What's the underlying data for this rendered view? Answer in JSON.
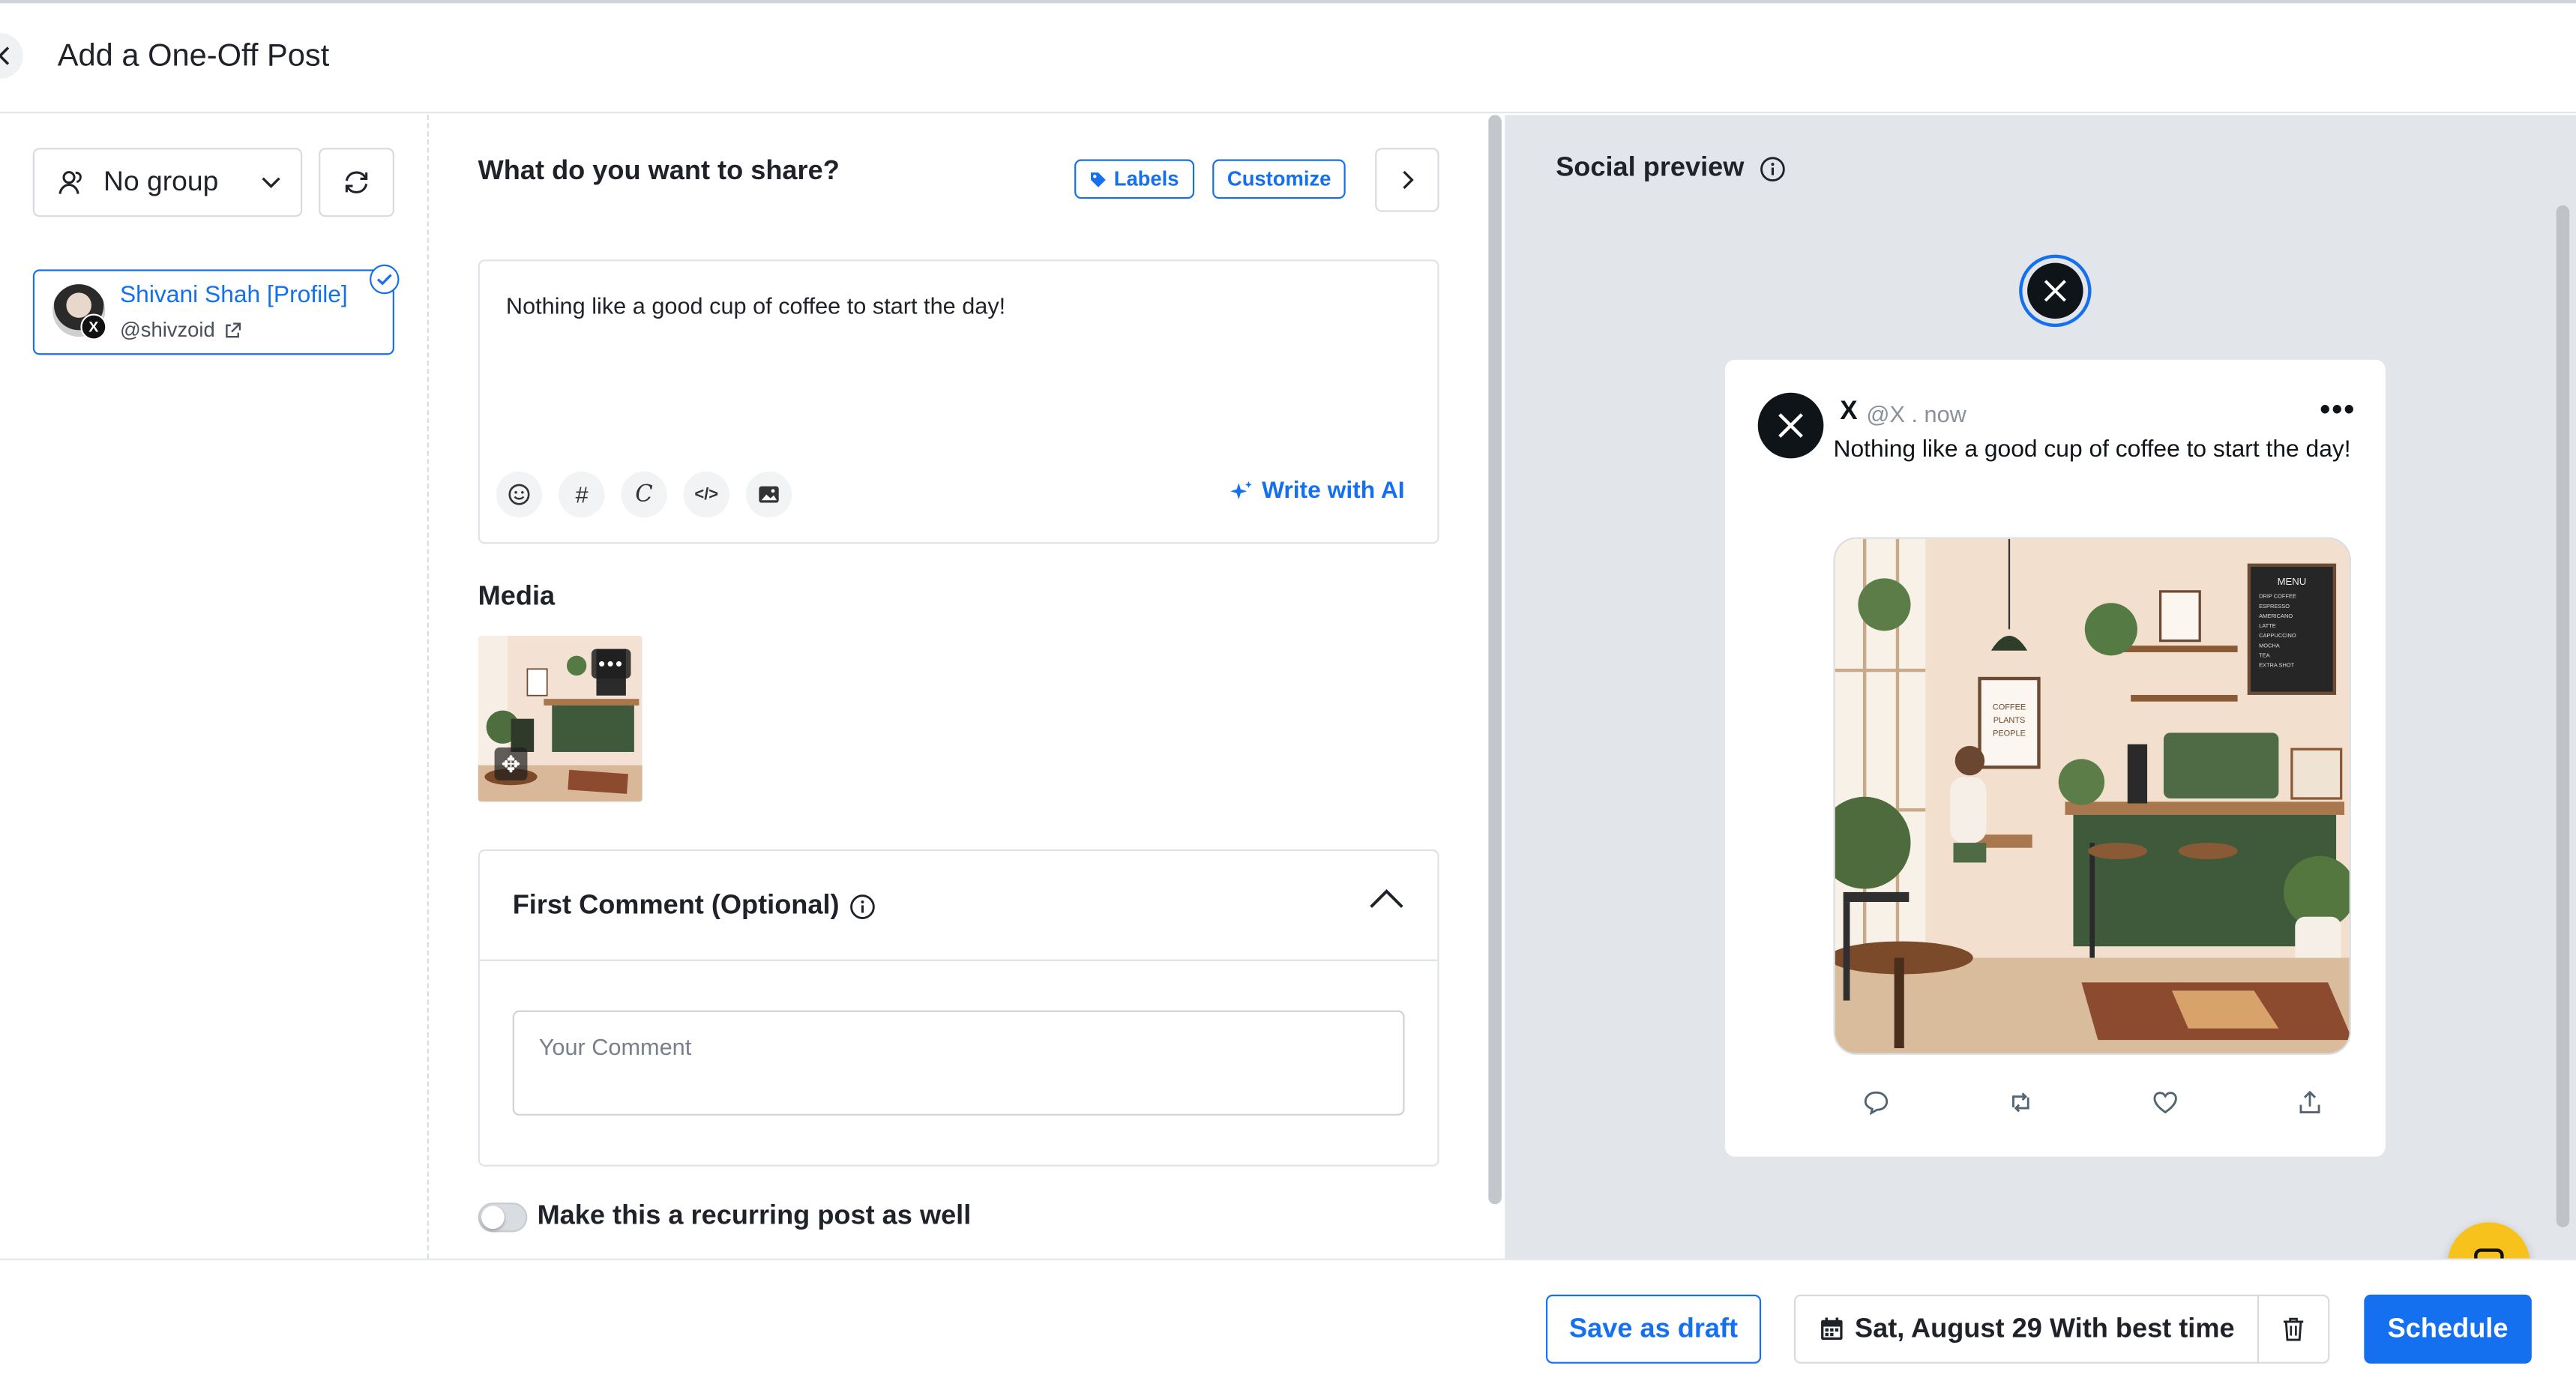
{
  "header": {
    "title": "Add a One-Off Post",
    "back_icon": "chevron-left-icon"
  },
  "left": {
    "group_select": {
      "value": "No group",
      "icon": "users-icon"
    },
    "refresh_icon": "refresh-icon",
    "profile": {
      "name": "Shivani Shah [Profile]",
      "handle": "@shivzoid",
      "network_badge": "X",
      "selected": true
    }
  },
  "composer": {
    "question": "What do you want to share?",
    "labels_button": "Labels",
    "customize_button": "Customize",
    "post_text": "Nothing like a good cup of coffee to start the day!",
    "tools": [
      "emoji-icon",
      "hashtag-icon",
      "canva-icon",
      "code-icon",
      "image-icon"
    ],
    "write_ai": "Write with AI",
    "media_label": "Media",
    "media_more": "•••",
    "first_comment": {
      "title": "First Comment (Optional)",
      "placeholder": "Your Comment",
      "value": ""
    },
    "recurring": {
      "label": "Make this a recurring post as well",
      "on": false
    }
  },
  "preview": {
    "title": "Social preview",
    "network": "X",
    "tweet": {
      "name": "X",
      "meta": "@X . now",
      "text": "Nothing like a good cup of coffee to start the day!",
      "actions": [
        "reply-icon",
        "repost-icon",
        "like-icon",
        "share-icon"
      ]
    },
    "image": {
      "sign_text": "COFFEE PLANTS PEOPLE",
      "menu_title": "MENU",
      "menu_items": [
        "DRIP COFFEE",
        "ESPRESSO",
        "AMERICANO",
        "LATTE",
        "CAPPUCCINO",
        "MOCHA",
        "TEA",
        "EXTRA SHOT"
      ]
    }
  },
  "footer": {
    "draft": "Save as draft",
    "date": "Sat, August 29 With best time",
    "schedule": "Schedule"
  },
  "colors": {
    "accent": "#1570ef",
    "preview_bg": "#e2e5e9",
    "fab": "#f7c21b"
  }
}
